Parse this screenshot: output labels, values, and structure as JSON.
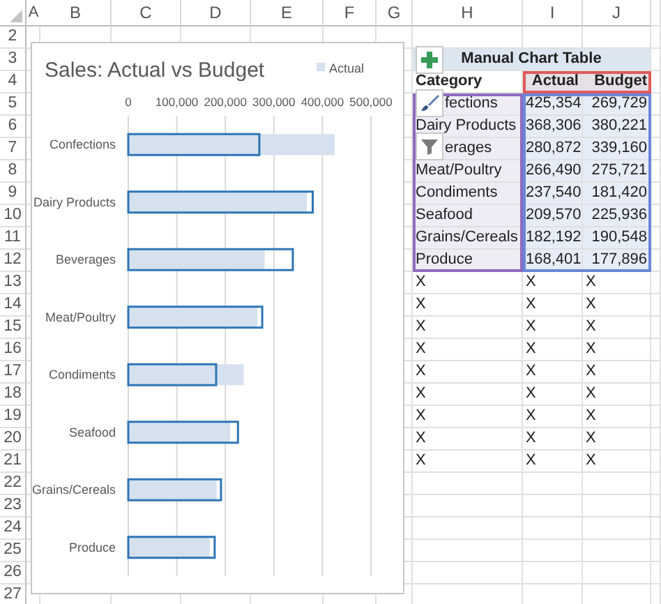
{
  "column_headers": [
    "A",
    "B",
    "C",
    "D",
    "E",
    "F",
    "G",
    "H",
    "I",
    "J"
  ],
  "row_headers": [
    "2",
    "3",
    "4",
    "5",
    "6",
    "7",
    "8",
    "9",
    "10",
    "11",
    "12",
    "13",
    "14",
    "15",
    "16",
    "17",
    "18",
    "19",
    "20",
    "21",
    "22",
    "23",
    "24",
    "25",
    "26",
    "27"
  ],
  "chart": {
    "chart_data": {
      "type": "bar",
      "orientation": "horizontal",
      "title": "Sales: Actual vs Budget",
      "categories": [
        "Confections",
        "Dairy Products",
        "Beverages",
        "Meat/Poultry",
        "Condiments",
        "Seafood",
        "Grains/Cereals",
        "Produce"
      ],
      "series": [
        {
          "name": "Actual",
          "color": "#d5e1ee",
          "values": [
            425000,
            368000,
            281000,
            266000,
            238000,
            210000,
            182000,
            168000
          ]
        },
        {
          "color": "#2e75b6",
          "values": [
            270000,
            380000,
            339000,
            276000,
            181000,
            226000,
            191000,
            178000
          ]
        }
      ],
      "grid": true,
      "xlim": [
        0,
        500000
      ],
      "xticks": [
        {
          "value": 0,
          "label": "0"
        },
        {
          "value": 100000,
          "label": "100,000"
        },
        {
          "value": 200000,
          "label": "200,000"
        },
        {
          "value": 300000,
          "label": "300,000"
        },
        {
          "value": 400000,
          "label": "400,000"
        },
        {
          "value": 500000,
          "label": "500,000"
        }
      ]
    }
  },
  "table": {
    "title": "Manual Chart Table",
    "columns": [
      "Category",
      "Actual",
      "Budget"
    ],
    "rows": [
      {
        "cells": [
          "fections",
          "425,354",
          "269,729"
        ],
        "clipped": true
      },
      {
        "cells": [
          "Dairy Products",
          "368,306",
          "380,221"
        ],
        "clipped": false
      },
      {
        "cells": [
          "erages",
          "280,872",
          "339,160"
        ],
        "clipped": true
      },
      {
        "cells": [
          "Meat/Poultry",
          "266,490",
          "275,721"
        ],
        "clipped": false
      },
      {
        "cells": [
          "Condiments",
          "237,540",
          "181,420"
        ],
        "clipped": false
      },
      {
        "cells": [
          "Seafood",
          "209,570",
          "225,936"
        ],
        "clipped": false
      },
      {
        "cells": [
          "Grains/Cereals",
          "182,192",
          "190,548"
        ],
        "clipped": false
      },
      {
        "cells": [
          "Produce",
          "168,401",
          "177,896"
        ],
        "clipped": false
      }
    ]
  },
  "marker_rows": [
    [
      "X",
      "X",
      "X"
    ],
    [
      "X",
      "X",
      "X"
    ],
    [
      "X",
      "X",
      "X"
    ],
    [
      "X",
      "X",
      "X"
    ],
    [
      "X",
      "X",
      "X"
    ],
    [
      "X",
      "X",
      "X"
    ],
    [
      "X",
      "X",
      "X"
    ],
    [
      "X",
      "X",
      "X"
    ],
    [
      "X",
      "X",
      "X"
    ]
  ]
}
